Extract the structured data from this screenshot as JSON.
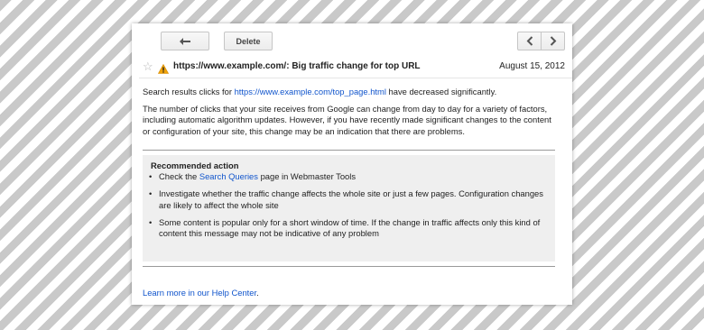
{
  "toolbar": {
    "back_icon": "reply-arrow-icon",
    "delete_label": "Delete",
    "prev_icon": "chevron-left-icon",
    "next_icon": "chevron-right-icon"
  },
  "message": {
    "star_icon": "star-outline-icon",
    "warning_icon": "warning-triangle-icon",
    "warning_color": "#f0a30a",
    "subject": "https://www.example.com/: Big traffic change for top URL",
    "date": "August 15, 2012",
    "p1_pre": "Search results clicks for ",
    "p1_link": "https://www.example.com/top_page.html",
    "p1_post": " have decreased significantly.",
    "p2": "The number of clicks that your site receives from Google can change from day to day for a variety of factors, including automatic algorithm updates. However, if you have recently made significant changes to the content or configuration of your site, this change may be an indication that there are problems.",
    "link_color": "#1155cc"
  },
  "recommended": {
    "title": "Recommended action",
    "bullet": "•",
    "item1_pre": "Check the ",
    "item1_link": "Search Queries",
    "item1_post": " page in Webmaster Tools",
    "item2": "Investigate whether the traffic change affects the whole site or just a few pages. Configuration changes are likely to affect the whole site",
    "item3": "Some content is popular only for a short window of time. If the change in traffic affects only this kind of content this message may not be indicative of any problem"
  },
  "footer": {
    "link": "Learn more in our Help Center",
    "post": "."
  }
}
